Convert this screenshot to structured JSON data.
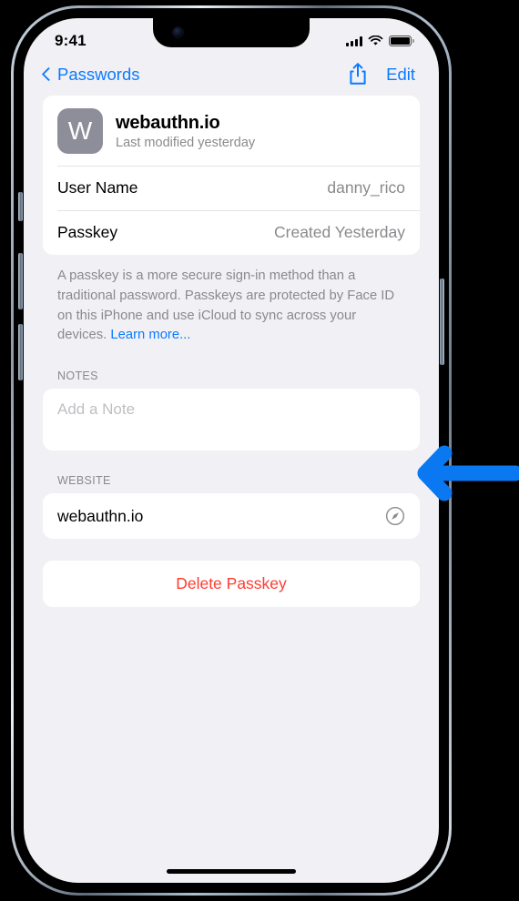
{
  "status_bar": {
    "time": "9:41",
    "cellular_icon": "signal-bars-icon",
    "wifi_icon": "wifi-icon",
    "battery_icon": "battery-full-icon"
  },
  "nav_bar": {
    "back_label": "Passwords",
    "back_icon": "chevron-left-icon",
    "share_icon": "share-icon",
    "edit_label": "Edit"
  },
  "detail_card": {
    "icon_letter": "W",
    "title": "webauthn.io",
    "subtitle": "Last modified yesterday",
    "rows": [
      {
        "label": "User Name",
        "value": "danny_rico"
      },
      {
        "label": "Passkey",
        "value": "Created Yesterday"
      }
    ]
  },
  "footnote": {
    "text": "A passkey is a more secure sign-in method than a traditional password. Passkeys are protected by Face ID on this iPhone and use iCloud to sync across your devices. ",
    "link_label": "Learn more..."
  },
  "notes_section": {
    "header": "NOTES",
    "placeholder": "Add a Note",
    "value": ""
  },
  "website_section": {
    "header": "WEBSITE",
    "value": "webauthn.io",
    "open_icon": "safari-compass-icon"
  },
  "delete_button": {
    "label": "Delete Passkey"
  },
  "annotation": {
    "arrow_icon": "left-arrow-callout-icon",
    "color": "#0A78F0"
  },
  "colors": {
    "accent_blue": "#0A7AFF",
    "destructive_red": "#FF3B30",
    "screen_background": "#F1F1F5",
    "card_background": "#FFFFFF",
    "secondary_text": "#8A8A8E",
    "app_icon_background": "#8E8E9A"
  }
}
